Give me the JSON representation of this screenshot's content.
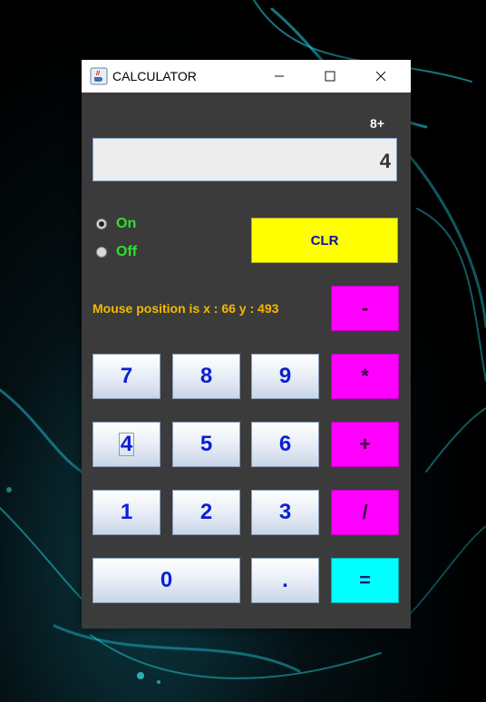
{
  "window": {
    "title": "CALCULATOR"
  },
  "display": {
    "label": "8+",
    "value": "4"
  },
  "power": {
    "on_label": "On",
    "off_label": "Off",
    "selected": "On"
  },
  "clear_label": "CLR",
  "mouse_status": "Mouse position is x : 66 y : 493",
  "keys": {
    "minus": "-",
    "multiply": "*",
    "plus": "+",
    "divide": "/",
    "equals": "=",
    "d7": "7",
    "d8": "8",
    "d9": "9",
    "d4": "4",
    "d5": "5",
    "d6": "6",
    "d1": "1",
    "d2": "2",
    "d3": "3",
    "d0": "0",
    "dot": "."
  },
  "colors": {
    "window_bg": "#3b3b3b",
    "operator": "#ff00ff",
    "equals": "#00ffff",
    "clear": "#ffff00",
    "radio_text": "#2ee02e",
    "status_text": "#f5b800",
    "digit_text": "#0b1fd6"
  }
}
